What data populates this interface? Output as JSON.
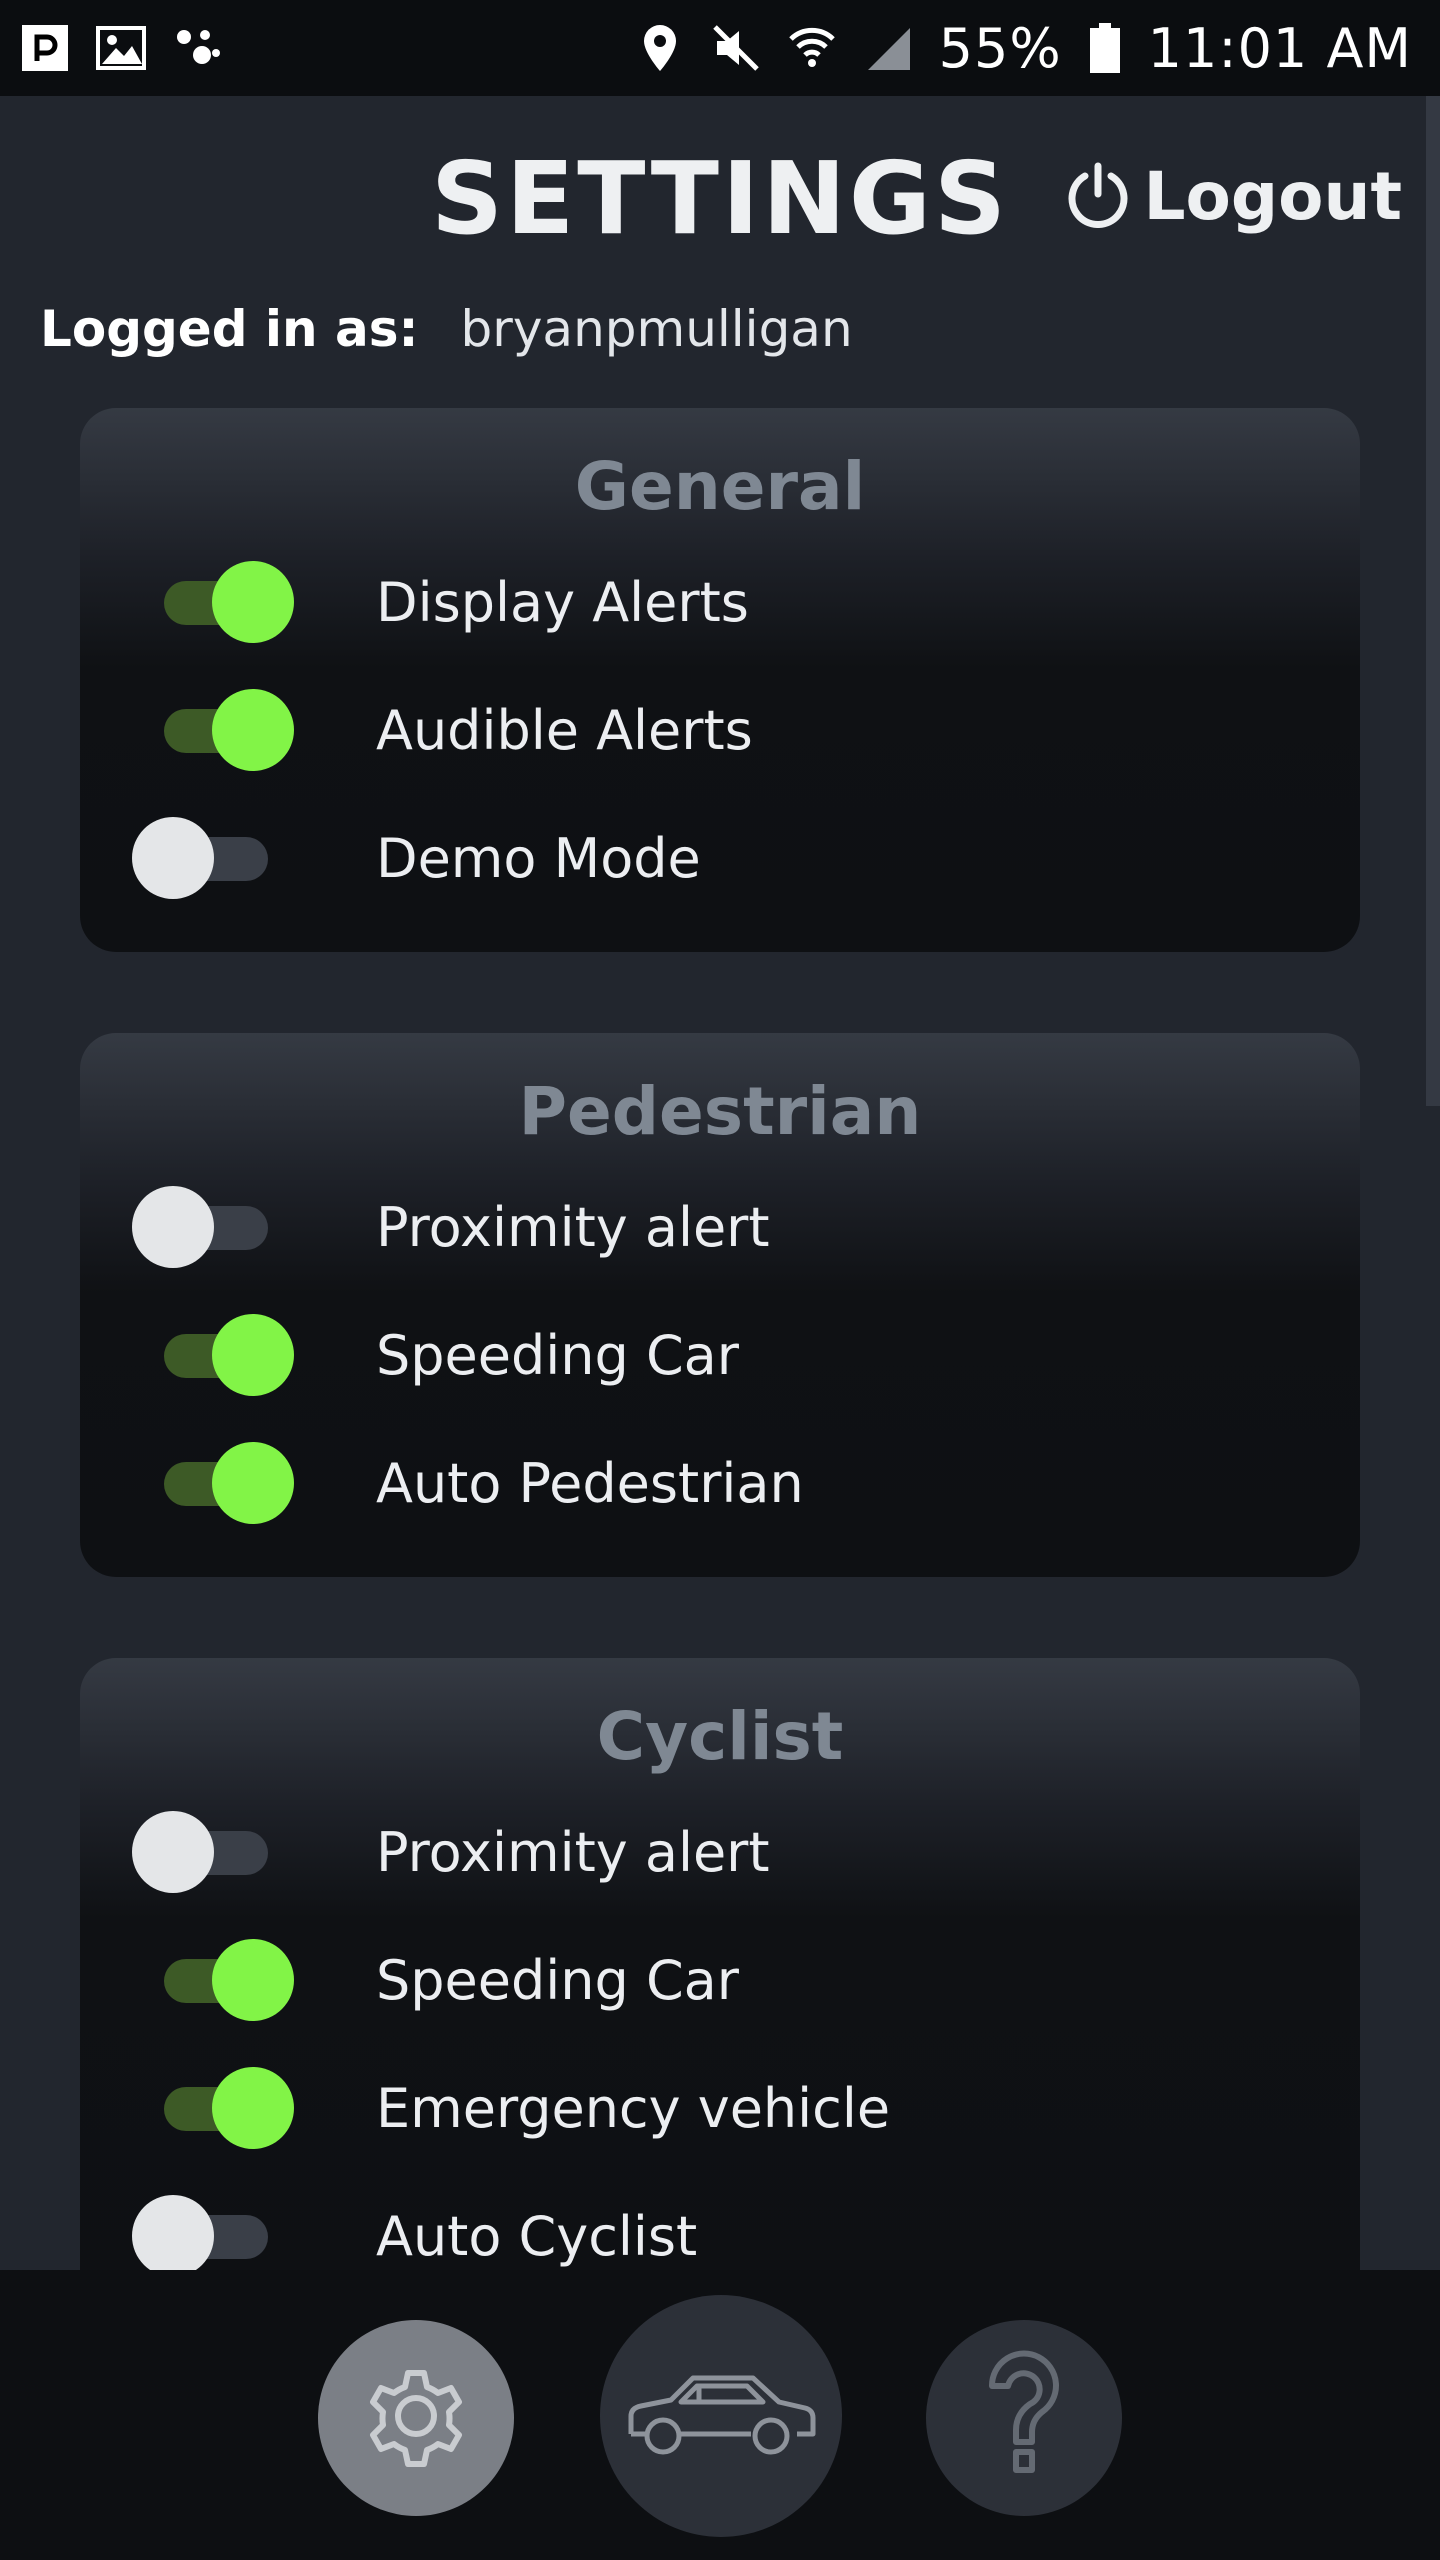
{
  "status_bar": {
    "battery_percent": "55%",
    "time": "11:01 AM",
    "icons": [
      "pandora-icon",
      "gallery-icon",
      "assistant-icon",
      "location-icon",
      "mute-icon",
      "wifi-icon",
      "signal-icon",
      "battery-icon"
    ]
  },
  "header": {
    "title": "SETTINGS",
    "logout_label": "Logout"
  },
  "account": {
    "label": "Logged in as:",
    "username": "bryanpmulligan"
  },
  "sections": [
    {
      "title": "General",
      "items": [
        {
          "label": "Display Alerts",
          "enabled": true
        },
        {
          "label": "Audible Alerts",
          "enabled": true
        },
        {
          "label": "Demo Mode",
          "enabled": false
        }
      ]
    },
    {
      "title": "Pedestrian",
      "items": [
        {
          "label": "Proximity alert",
          "enabled": false
        },
        {
          "label": "Speeding Car",
          "enabled": true
        },
        {
          "label": "Auto Pedestrian",
          "enabled": true
        }
      ]
    },
    {
      "title": "Cyclist",
      "items": [
        {
          "label": "Proximity alert",
          "enabled": false
        },
        {
          "label": "Speeding Car",
          "enabled": true
        },
        {
          "label": "Emergency vehicle",
          "enabled": true
        },
        {
          "label": "Auto Cyclist",
          "enabled": false
        }
      ]
    }
  ],
  "bottom_nav": [
    {
      "name": "settings",
      "icon": "gear-icon",
      "active": true
    },
    {
      "name": "car",
      "icon": "car-icon",
      "active": false
    },
    {
      "name": "help",
      "icon": "question-icon",
      "active": false
    }
  ],
  "colors": {
    "toggle_on_knob": "#82f447",
    "toggle_on_track": "#3d5a26",
    "toggle_off_knob": "#e4e6e8",
    "background": "#22262e"
  }
}
